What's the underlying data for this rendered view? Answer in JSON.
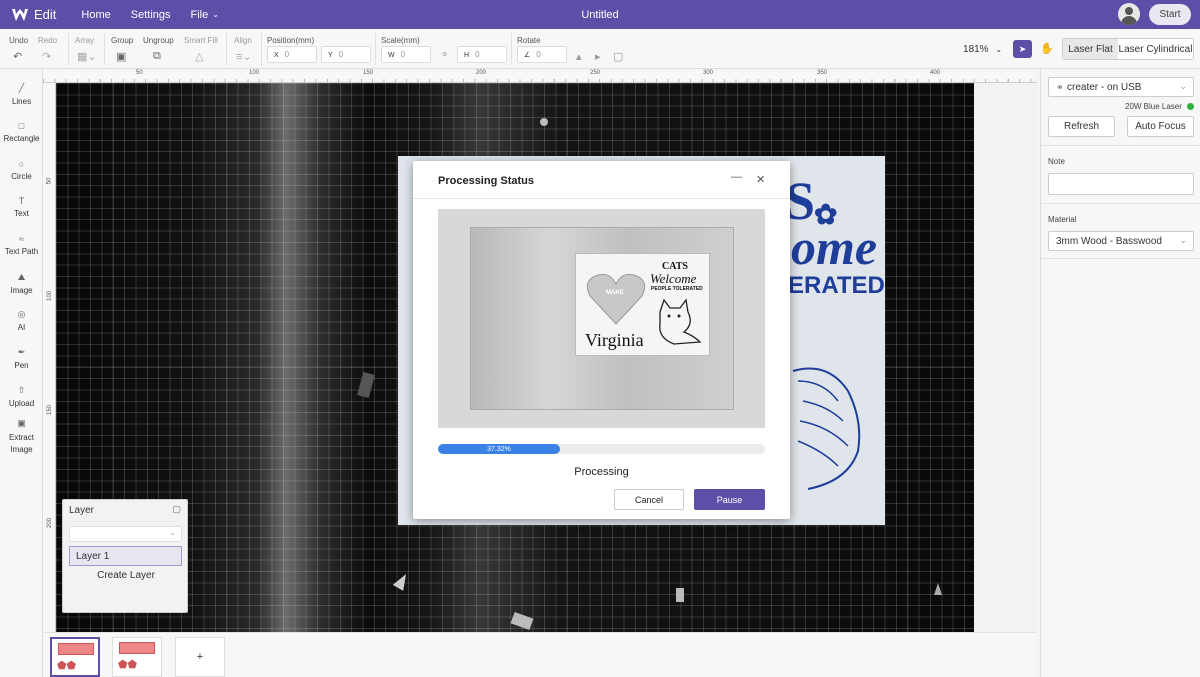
{
  "app": {
    "logo_text": "Edit",
    "title": "Untitled",
    "nav": [
      "Home",
      "Settings",
      "File"
    ],
    "start_label": "Start"
  },
  "toolbar": {
    "undo": "Undo",
    "redo": "Redo",
    "array": "Array",
    "group": "Group",
    "ungroup": "Ungroup",
    "smart_fill": "Smart Fill",
    "align": "Align",
    "position": "Position(mm)",
    "scale": "Scale(mm)",
    "rotate": "Rotate",
    "x_key": "X",
    "x_val": "0",
    "y_key": "Y",
    "y_val": "0",
    "w_key": "W",
    "w_val": "0",
    "h_key": "H",
    "h_val": "0",
    "r_val": "0",
    "zoom": "181%",
    "laser_flat": "Laser Flat",
    "laser_cylindrical": "Laser Cylindrical"
  },
  "ruler": {
    "top": [
      "50",
      "100",
      "150",
      "200",
      "250",
      "300",
      "350",
      "400"
    ],
    "left": [
      "50",
      "100",
      "150",
      "200"
    ]
  },
  "tools": [
    {
      "label": "Lines",
      "icon": "lines-icon"
    },
    {
      "label": "Rectangle",
      "icon": "rectangle-icon"
    },
    {
      "label": "Circle",
      "icon": "circle-icon"
    },
    {
      "label": "Text",
      "icon": "text-icon"
    },
    {
      "label": "Text Path",
      "icon": "text-path-icon"
    },
    {
      "label": "Image",
      "icon": "image-icon"
    },
    {
      "label": "AI",
      "icon": "ai-icon"
    },
    {
      "label": "Pen",
      "icon": "pen-icon"
    },
    {
      "label": "Upload",
      "icon": "upload-icon"
    },
    {
      "label": "Extract Image",
      "icon": "extract-image-icon"
    }
  ],
  "right_panel": {
    "device": "creater - on USB",
    "laser": "20W Blue Laser",
    "refresh": "Refresh",
    "auto_focus": "Auto Focus",
    "note_label": "Note",
    "material_label": "Material",
    "material": "3mm Wood - Basswood",
    "status_color": "#2fb13d"
  },
  "layer_panel": {
    "title": "Layer",
    "layer_name": "Layer 1",
    "create": "Create Layer"
  },
  "thumbnails": {
    "add_label": "+"
  },
  "modal": {
    "title": "Processing Status",
    "progress_text": "37.32%",
    "progress": 0.3732,
    "status": "Processing",
    "cancel": "Cancel",
    "pause": "Pause",
    "sign": {
      "cats": "CATS",
      "welcome": "Welcome",
      "tolerated": "PEOPLE TOLERATED",
      "make": "MAKE",
      "name": "Virginia"
    }
  },
  "canvas_board": {
    "line1": "S",
    "line2": "ome",
    "line3": "ERATED"
  },
  "colors": {
    "accent": "#5f4ea8",
    "progress": "#3b82e6"
  }
}
